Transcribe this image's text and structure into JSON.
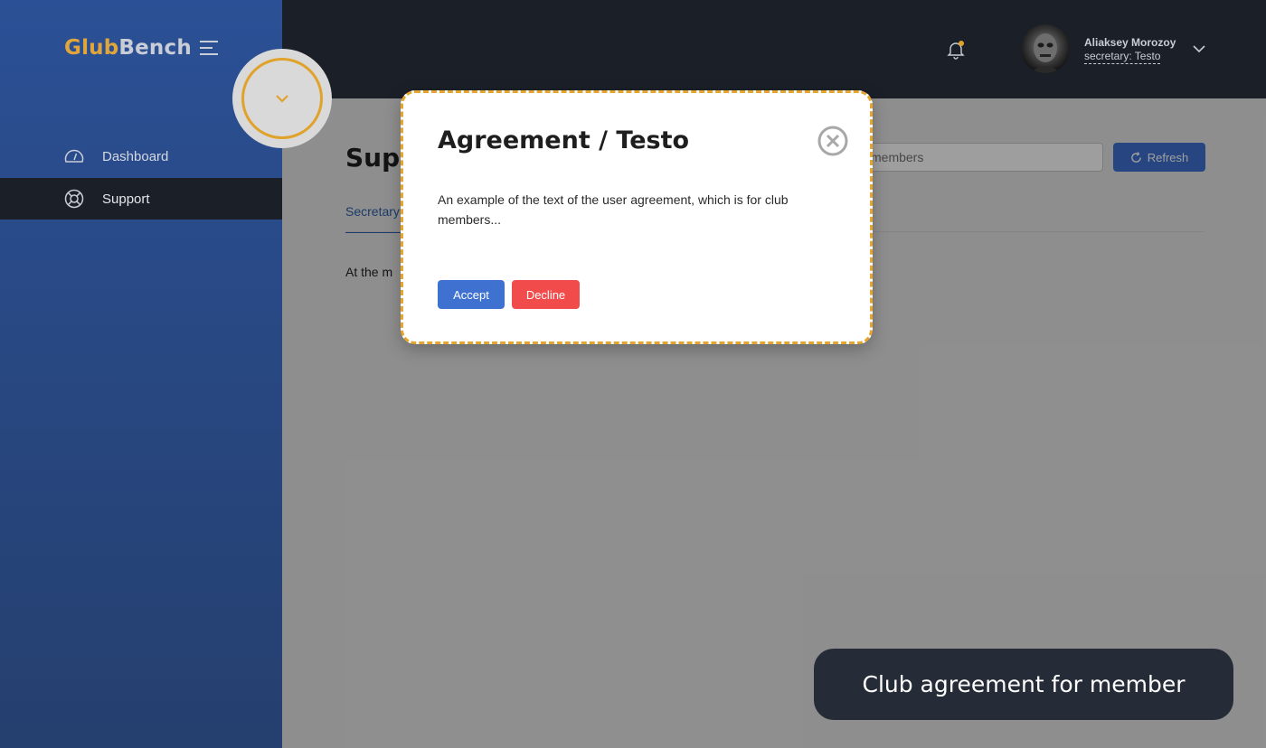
{
  "brand": {
    "part1": "Glub",
    "part2": "Bench"
  },
  "sidebar": {
    "items": [
      {
        "label": "Dashboard",
        "icon": "speedometer-icon",
        "active": false
      },
      {
        "label": "Support",
        "icon": "lifebuoy-icon",
        "active": true
      }
    ]
  },
  "header": {
    "user_name": "Aliaksey Morozoy",
    "user_role": "secretary: Testo",
    "notification_dot_color": "#e0a22a"
  },
  "main": {
    "title": "Supp",
    "active_tab": "Secretary",
    "text": "At the m",
    "search_placeholder": "members",
    "refresh_label": "Refresh"
  },
  "modal": {
    "title": "Agreement / Testo",
    "body": "An example of the text of the user agreement, which is for club members...",
    "accept_label": "Accept",
    "decline_label": "Decline"
  },
  "caption": "Club agreement for member",
  "colors": {
    "accent": "#e0a22a",
    "primary": "#3f72d0",
    "danger": "#f24b4b",
    "sidebar": "#2b5095",
    "topbar": "#1b1f27"
  }
}
